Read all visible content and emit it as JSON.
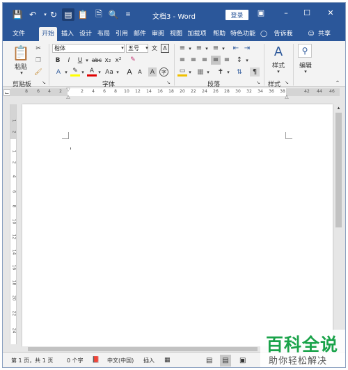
{
  "titlebar": {
    "title": "文档3 - Word",
    "login_label": "登录",
    "icons": [
      "save-icon",
      "undo-icon",
      "redo-icon",
      "document-icon",
      "paste-icon",
      "new-file-icon",
      "print-preview-icon",
      "customize-icon"
    ]
  },
  "tabs": [
    {
      "label": "文件"
    },
    {
      "label": "开始"
    },
    {
      "label": "插入"
    },
    {
      "label": "设计"
    },
    {
      "label": "布局"
    },
    {
      "label": "引用"
    },
    {
      "label": "邮件"
    },
    {
      "label": "审阅"
    },
    {
      "label": "视图"
    },
    {
      "label": "加载项"
    },
    {
      "label": "帮助"
    },
    {
      "label": "特色功能"
    },
    {
      "label": "告诉我"
    },
    {
      "label": "共享"
    }
  ],
  "ribbon": {
    "clipboard": {
      "paste_label": "粘贴",
      "group_label": "剪贴板"
    },
    "font": {
      "font_name": "楷体",
      "font_size": "五号",
      "group_label": "字体",
      "bold": "B",
      "italic": "I",
      "underline": "U",
      "strike": "abc",
      "sub": "x₂",
      "sup": "x²",
      "font_color": "A",
      "case": "Aa",
      "grow": "A",
      "shrink": "A",
      "clear": "A"
    },
    "paragraph": {
      "group_label": "段落"
    },
    "styles": {
      "label": "样式",
      "group_label": "样式"
    },
    "editing": {
      "label": "编辑"
    }
  },
  "ruler": {
    "h_ticks": [
      "8",
      "6",
      "4",
      "2",
      "2",
      "4",
      "6",
      "8",
      "10",
      "12",
      "14",
      "16",
      "18",
      "20",
      "22",
      "24",
      "26",
      "28",
      "30",
      "32",
      "34",
      "36",
      "38",
      "42",
      "44",
      "46"
    ],
    "v_ticks": [
      "1",
      "2",
      "1",
      "2",
      "4",
      "6",
      "8",
      "10",
      "12",
      "14",
      "16",
      "18",
      "20",
      "22",
      "24"
    ]
  },
  "status": {
    "page": "第 1 页，共 1 页",
    "words": "0 个字",
    "language": "中文(中国)",
    "mode": "插入"
  },
  "watermark": {
    "line1": "百科全说",
    "line2": "助你轻松解决"
  }
}
